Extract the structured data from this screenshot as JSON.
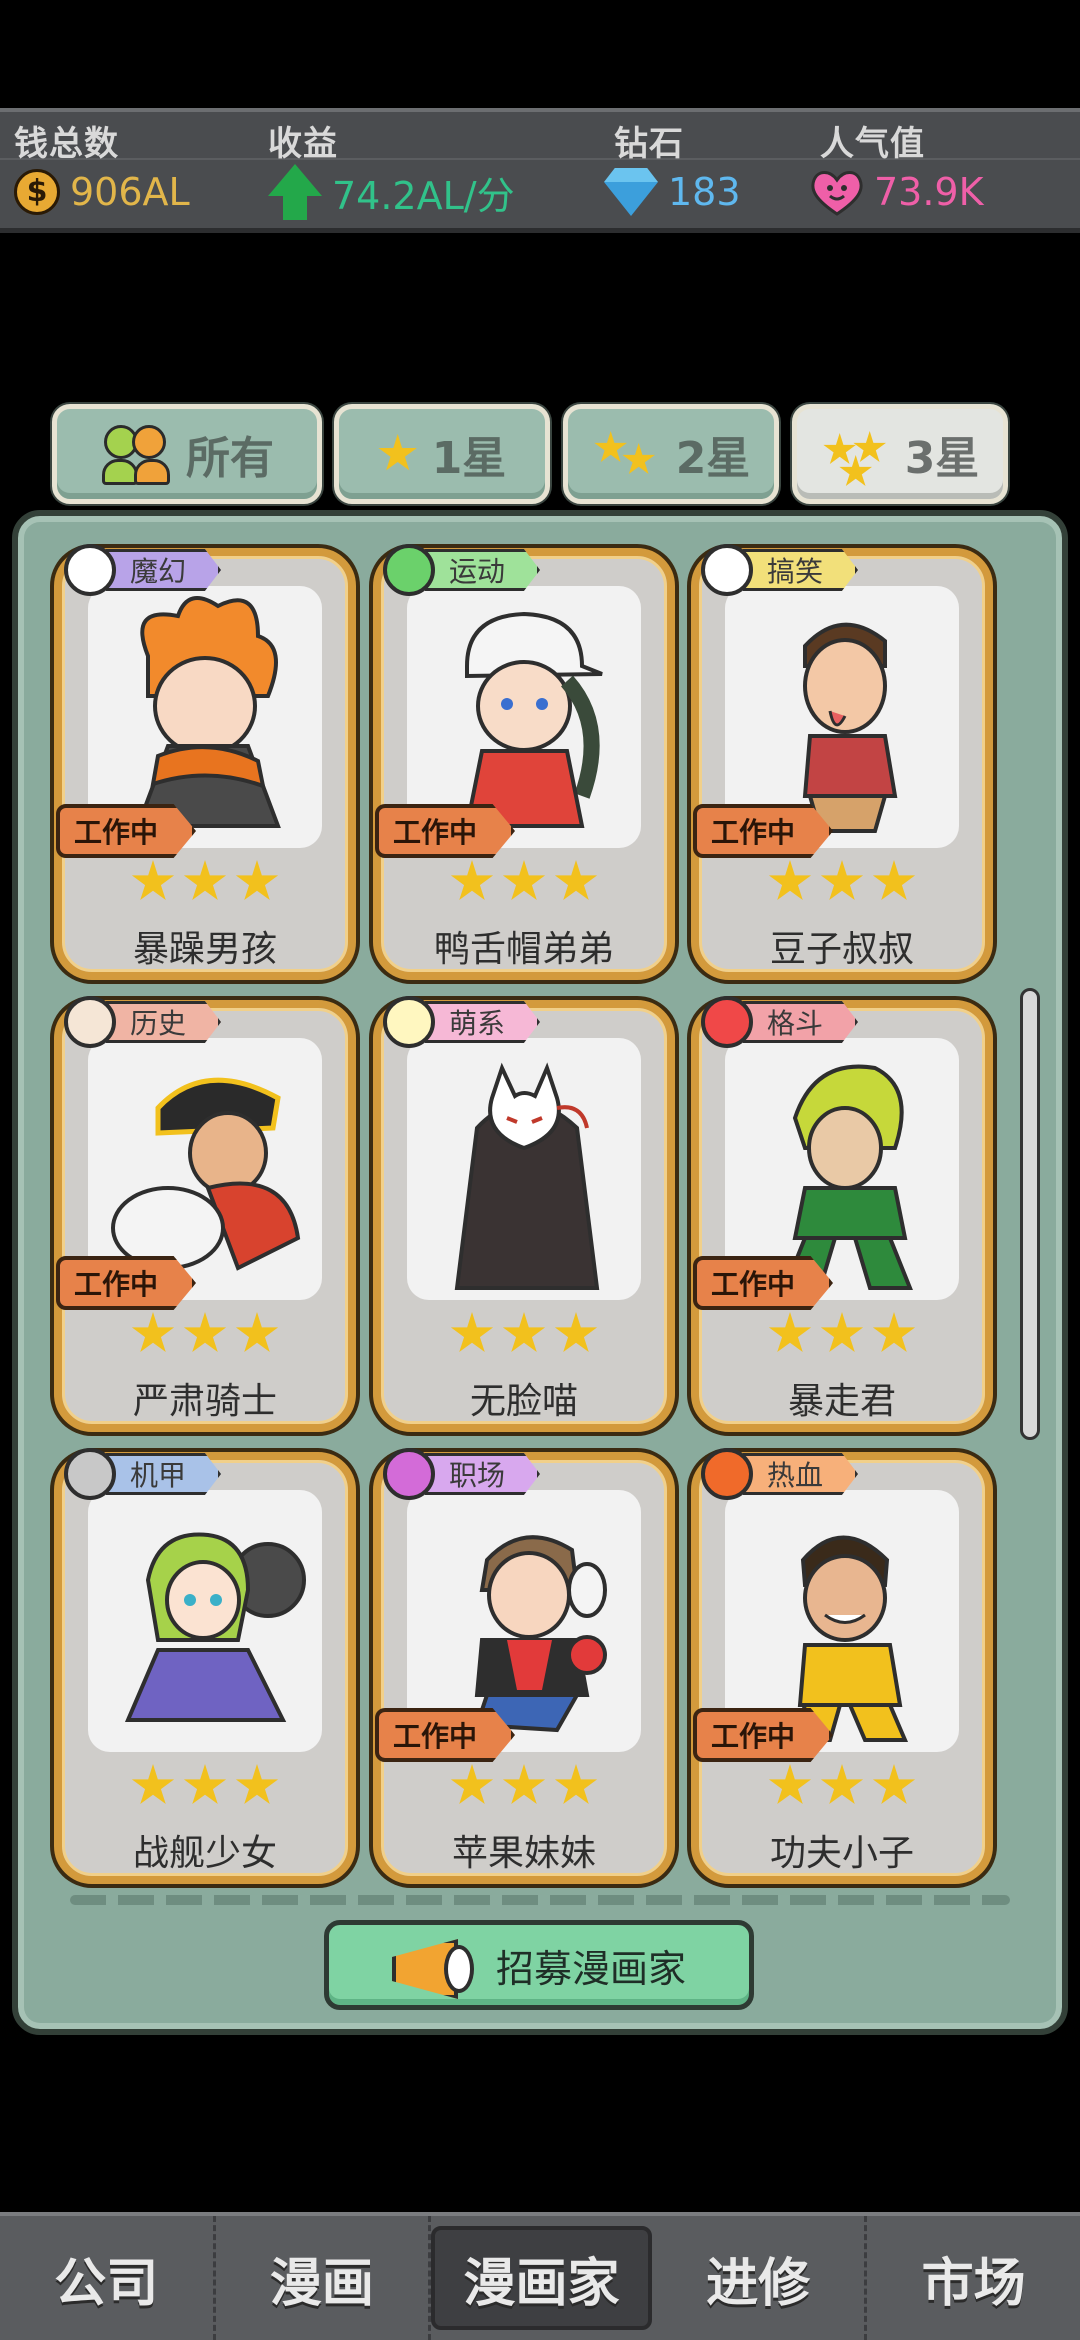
{
  "stats": [
    {
      "label": "钱总数",
      "value": "906AL",
      "icon": "coin-icon",
      "color": "#e2b64a"
    },
    {
      "label": "收益",
      "value": "74.2AL/分",
      "icon": "arrow-up-icon",
      "color": "#31c28a"
    },
    {
      "label": "钻石",
      "value": "183",
      "icon": "diamond-icon",
      "color": "#5fb8ef"
    },
    {
      "label": "人气值",
      "value": "73.9K",
      "icon": "heart-icon",
      "color": "#ef5fa8"
    }
  ],
  "tabs": [
    {
      "label": "所有",
      "active": false
    },
    {
      "label": "1星",
      "active": false
    },
    {
      "label": "2星",
      "active": false
    },
    {
      "label": "3星",
      "active": true
    }
  ],
  "cards": [
    {
      "name": "暴躁男孩",
      "genre": "魔幻",
      "genre_color": "#b8a3e8",
      "status": "工作中",
      "stars": 3
    },
    {
      "name": "鸭舌帽弟弟",
      "genre": "运动",
      "genre_color": "#9fe29a",
      "status": "工作中",
      "stars": 3
    },
    {
      "name": "豆子叔叔",
      "genre": "搞笑",
      "genre_color": "#f2e07a",
      "status": "工作中",
      "stars": 3
    },
    {
      "name": "严肃骑士",
      "genre": "历史",
      "genre_color": "#f0b4a4",
      "status": "工作中",
      "stars": 3
    },
    {
      "name": "无脸喵",
      "genre": "萌系",
      "genre_color": "#f6b8d6",
      "status": "",
      "stars": 3
    },
    {
      "name": "暴走君",
      "genre": "格斗",
      "genre_color": "#f2a2a8",
      "status": "工作中",
      "stars": 3
    },
    {
      "name": "战舰少女",
      "genre": "机甲",
      "genre_color": "#a9c2e8",
      "status": "",
      "stars": 3
    },
    {
      "name": "苹果妹妹",
      "genre": "职场",
      "genre_color": "#d8a8ee",
      "status": "工作中",
      "stars": 3
    },
    {
      "name": "功夫小子",
      "genre": "热血",
      "genre_color": "#f7b07a",
      "status": "工作中",
      "stars": 3
    }
  ],
  "recruit_label": "招募漫画家",
  "nav": [
    {
      "label": "公司",
      "active": false
    },
    {
      "label": "漫画",
      "active": false
    },
    {
      "label": "漫画家",
      "active": true
    },
    {
      "label": "进修",
      "active": false
    },
    {
      "label": "市场",
      "active": false
    }
  ]
}
